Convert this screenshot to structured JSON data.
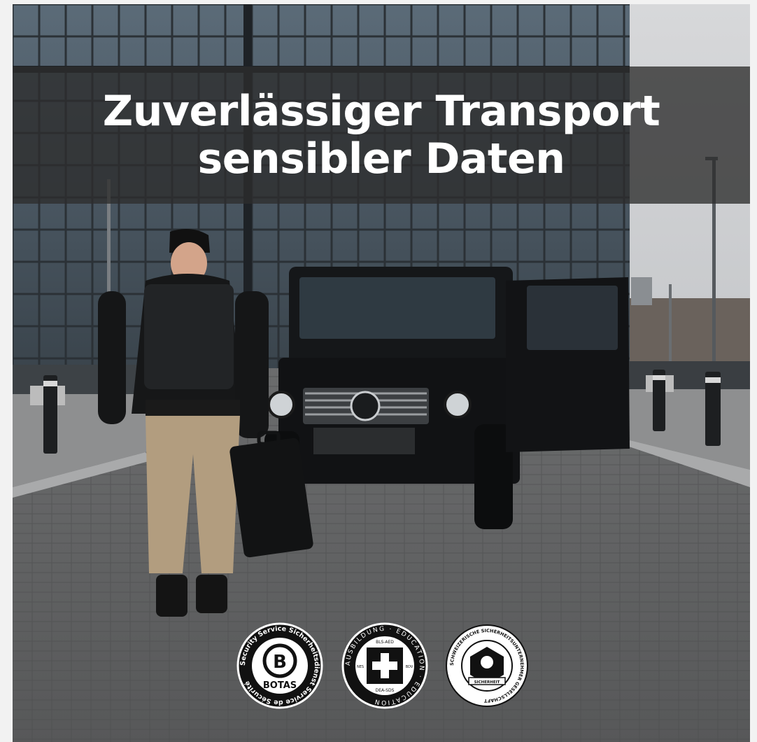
{
  "headline": {
    "line1": "Zuverlässiger Transport",
    "line2": "sensibler Daten"
  },
  "badges": [
    {
      "ring_text": "Security Service Sicherheitsdienst Service de Sécurité",
      "initial": "B",
      "label": "BOTAS"
    },
    {
      "ring_text": "AUSBILDUNG · EDUCATION · EDUCATION",
      "top_label": "BLS-AED",
      "bottom_label": "DEA-SDS",
      "left_label": "NES",
      "right_label": "BDV"
    },
    {
      "ring_text": "SCHWEIZERISCHE SICHERHEITSUNTERNEHMER GESELLSCHAFT",
      "label": "SICHERHEIT"
    }
  ],
  "colors": {
    "band": "#2d2d2d",
    "text": "#ffffff",
    "badge_bg": "#111111"
  }
}
